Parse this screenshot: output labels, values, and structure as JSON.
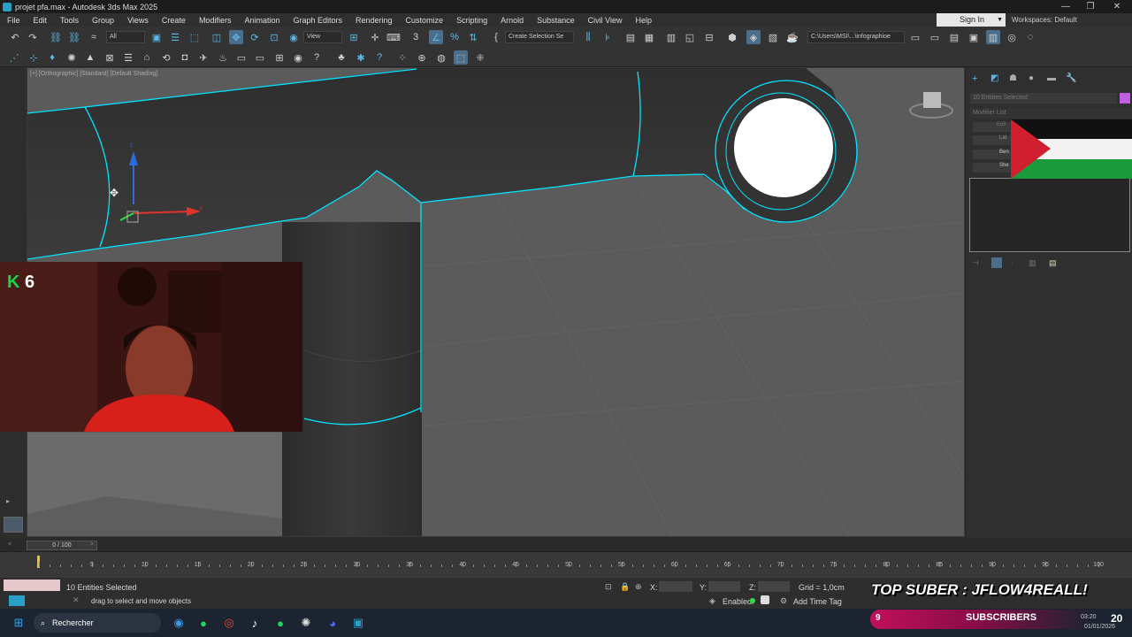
{
  "window": {
    "title": "projet pfa.max - Autodesk 3ds Max 2025",
    "minimize": "—",
    "restore": "❐",
    "close": "✕"
  },
  "menu": [
    "File",
    "Edit",
    "Tools",
    "Group",
    "Views",
    "Create",
    "Modifiers",
    "Animation",
    "Graph Editors",
    "Rendering",
    "Customize",
    "Scripting",
    "Arnold",
    "Substance",
    "Civil View",
    "Help"
  ],
  "account": {
    "signin": "Sign In",
    "workspaces_label": "Workspaces:",
    "workspace": "Default"
  },
  "toolbar": {
    "filter": "All",
    "view": "View",
    "selection_set": "Create Selection Se",
    "path": "C:\\Users\\MSI\\...\\infographioe"
  },
  "viewport": {
    "label": "[+] [Orthographic] [Standard] [Default Shading]",
    "axis_x": "x",
    "axis_z": "z"
  },
  "command_panel": {
    "selection": "10 Entities Selected",
    "modifier_list": "Modifier List",
    "buttons": [
      "Edit",
      "Lat",
      "Ben",
      "She"
    ]
  },
  "webcam": {
    "kill_icon": "K",
    "kill_count": "6"
  },
  "timeline": {
    "frame": "0 / 100",
    "ticks": [
      "5",
      "10",
      "15",
      "20",
      "25",
      "30",
      "35",
      "40",
      "45",
      "50",
      "55",
      "60",
      "65",
      "70",
      "75",
      "80",
      "85",
      "90",
      "95",
      "100"
    ]
  },
  "status": {
    "selected": "10 Entities Selected",
    "hint": "drag to select and move objects",
    "x_label": "X:",
    "y_label": "Y:",
    "z_label": "Z:",
    "grid": "Grid = 1,0cm",
    "enabled": "Enabled:",
    "add_time_tag": "Add Time Tag"
  },
  "taskbar": {
    "search": "Rechercher",
    "time": "03:20",
    "date": "01/01/2026"
  },
  "stream": {
    "top_sub": "TOP SUBER : JFLOW4REALL!",
    "sub_count": "9",
    "sub_label": "SUBSCRIBERS",
    "goal": "20"
  },
  "colors": {
    "selection": "#00e5ff",
    "accent": "#4a6e8c"
  }
}
